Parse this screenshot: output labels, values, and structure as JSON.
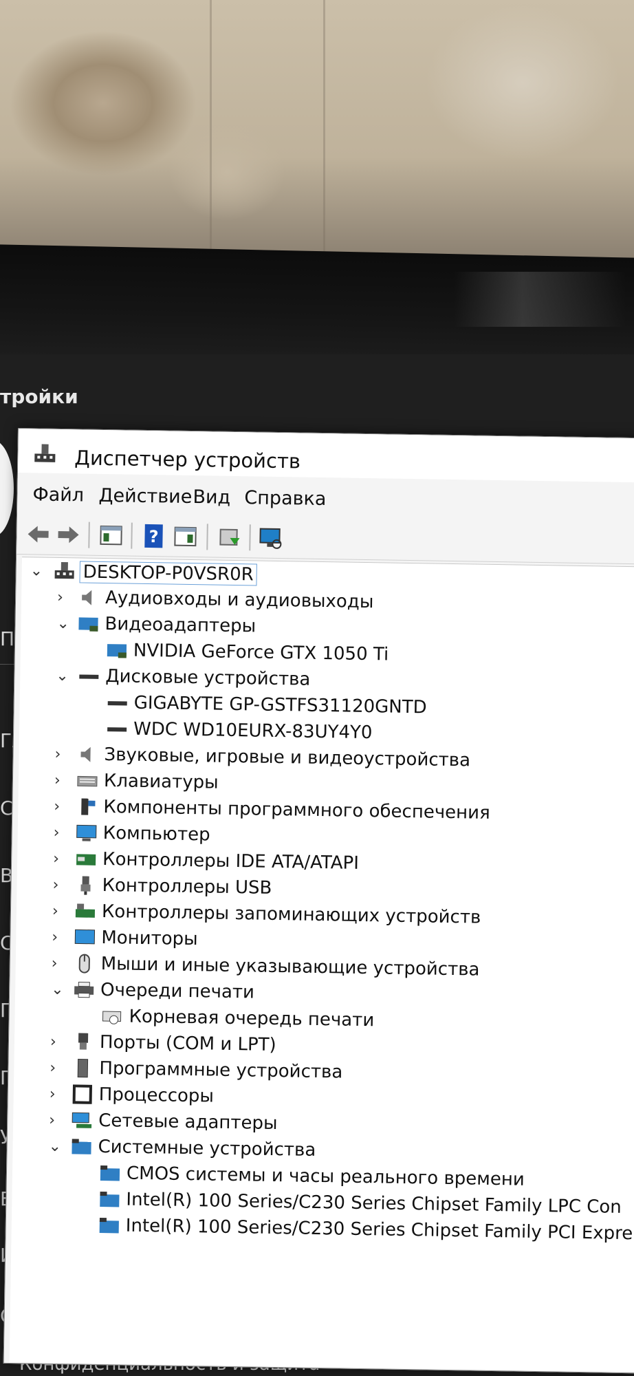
{
  "settings": {
    "title_fragment": "тройки",
    "side_labels": [
      "П",
      "Гла",
      "Си",
      "Blu",
      "Се",
      "Пе",
      "Пр",
      "Уч",
      "Вр",
      "Иг",
      "Сп"
    ],
    "bottom_text": "Конфиденциальность и защита"
  },
  "device_manager": {
    "title": "Диспетчер устройств",
    "menu": [
      "Файл",
      "Действие",
      "Вид",
      "Справка"
    ],
    "toolbar": [
      "back-icon",
      "forward-icon",
      "properties-pane-icon",
      "help-icon",
      "details-pane-icon",
      "update-driver-icon",
      "scan-hardware-icon"
    ],
    "root": "DESKTOP-P0VSR0R",
    "tree": [
      {
        "label": "Аудиовходы и аудиовыходы",
        "expanded": false,
        "icon": "speaker-icon"
      },
      {
        "label": "Видеоадаптеры",
        "expanded": true,
        "icon": "display-adapter-icon"
      },
      {
        "label": "NVIDIA GeForce GTX 1050 Ti",
        "child": true,
        "icon": "display-adapter-icon"
      },
      {
        "label": "Дисковые устройства",
        "expanded": true,
        "icon": "disk-icon"
      },
      {
        "label": "GIGABYTE GP-GSTFS31120GNTD",
        "child": true,
        "icon": "disk-icon"
      },
      {
        "label": "WDC WD10EURX-83UY4Y0",
        "child": true,
        "icon": "disk-icon"
      },
      {
        "label": "Звуковые, игровые и видеоустройства",
        "expanded": false,
        "icon": "speaker-icon"
      },
      {
        "label": "Клавиатуры",
        "expanded": false,
        "icon": "keyboard-icon"
      },
      {
        "label": "Компоненты программного обеспечения",
        "expanded": false,
        "icon": "software-component-icon"
      },
      {
        "label": "Компьютер",
        "expanded": false,
        "icon": "computer-icon"
      },
      {
        "label": "Контроллеры IDE ATA/ATAPI",
        "expanded": false,
        "icon": "ide-controller-icon"
      },
      {
        "label": "Контроллеры USB",
        "expanded": false,
        "icon": "usb-icon"
      },
      {
        "label": "Контроллеры запоминающих устройств",
        "expanded": false,
        "icon": "storage-controller-icon"
      },
      {
        "label": "Мониторы",
        "expanded": false,
        "icon": "monitor-icon"
      },
      {
        "label": "Мыши и иные указывающие устройства",
        "expanded": false,
        "icon": "mouse-icon"
      },
      {
        "label": "Очереди печати",
        "expanded": true,
        "icon": "printer-icon"
      },
      {
        "label": "Корневая очередь печати",
        "child": true,
        "icon": "print-queue-icon"
      },
      {
        "label": "Порты (COM и LPT)",
        "expanded": false,
        "icon": "port-icon"
      },
      {
        "label": "Программные устройства",
        "expanded": false,
        "icon": "software-device-icon"
      },
      {
        "label": "Процессоры",
        "expanded": false,
        "icon": "processor-icon"
      },
      {
        "label": "Сетевые адаптеры",
        "expanded": false,
        "icon": "network-adapter-icon"
      },
      {
        "label": "Системные устройства",
        "expanded": true,
        "icon": "system-device-icon"
      },
      {
        "label": "CMOS системы и часы реального времени",
        "child": true,
        "icon": "system-device-icon"
      },
      {
        "label": "Intel(R) 100 Series/C230 Series Chipset Family LPC Con",
        "child": true,
        "icon": "system-device-icon"
      },
      {
        "label": "Intel(R) 100 Series/C230 Series Chipset Family PCI Expre",
        "child": true,
        "icon": "system-device-icon"
      }
    ]
  }
}
